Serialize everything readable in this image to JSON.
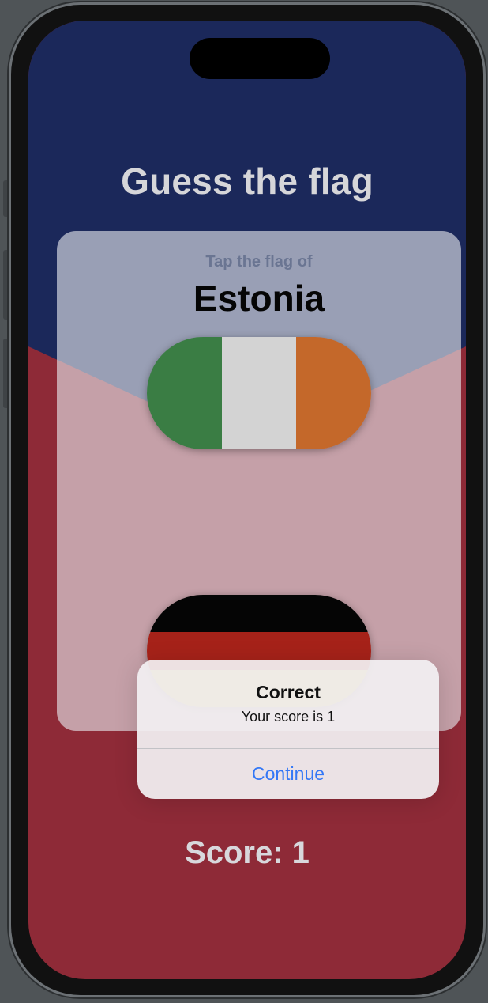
{
  "app": {
    "title": "Guess the flag",
    "prompt": "Tap the flag of",
    "country": "Estonia",
    "score_text": "Score: 1"
  },
  "flags": [
    {
      "name": "ireland-flag",
      "stripes": [
        "#3a7d44",
        "#d3d3d3",
        "#c4682a"
      ],
      "orientation": "vertical"
    },
    {
      "name": "germany-flag",
      "stripes": [
        "#050505",
        "#a62219",
        "#c9a63a"
      ],
      "orientation": "horizontal"
    }
  ],
  "alert": {
    "title": "Correct",
    "message": "Your score is 1",
    "button": "Continue"
  },
  "colors": {
    "background_top": "#1b285a",
    "background_bottom": "#8e2a37",
    "alert_button": "#3478f6"
  }
}
